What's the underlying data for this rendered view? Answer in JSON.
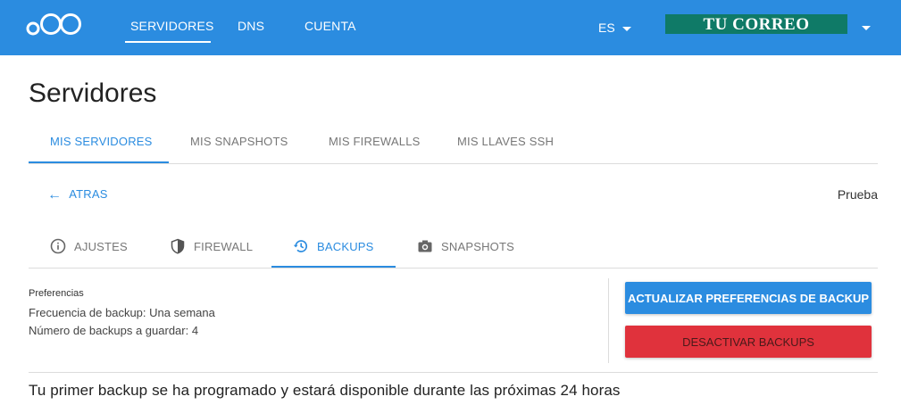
{
  "topbar": {
    "color": "#2b8ce0",
    "nav": [
      "SERVIDORES",
      "DNS",
      "CUENTA"
    ],
    "language": "ES",
    "account": "TU CORREO"
  },
  "page": {
    "title": "Servidores"
  },
  "main_tabs": [
    "MIS SERVIDORES",
    "MIS SNAPSHOTS",
    "MIS FIREWALLS",
    "MIS LLAVES SSH"
  ],
  "back_label": "ATRAS",
  "server_name": "Prueba",
  "sub_tabs": [
    {
      "label": "AJUSTES",
      "icon": "info-icon"
    },
    {
      "label": "FIREWALL",
      "icon": "shield-icon"
    },
    {
      "label": "BACKUPS",
      "icon": "history-icon"
    },
    {
      "label": "SNAPSHOTS",
      "icon": "camera-icon"
    }
  ],
  "preferences": {
    "title": "Preferencias",
    "frequency": "Frecuencia de backup: Una semana",
    "count": "Número de backups a guardar: 4"
  },
  "buttons": {
    "update": "ACTUALIZAR PREFERENCIAS DE BACKUP",
    "deactivate": "DESACTIVAR BACKUPS"
  },
  "notice": "Tu primer backup se ha programado y estará disponible durante las próximas 24 horas"
}
